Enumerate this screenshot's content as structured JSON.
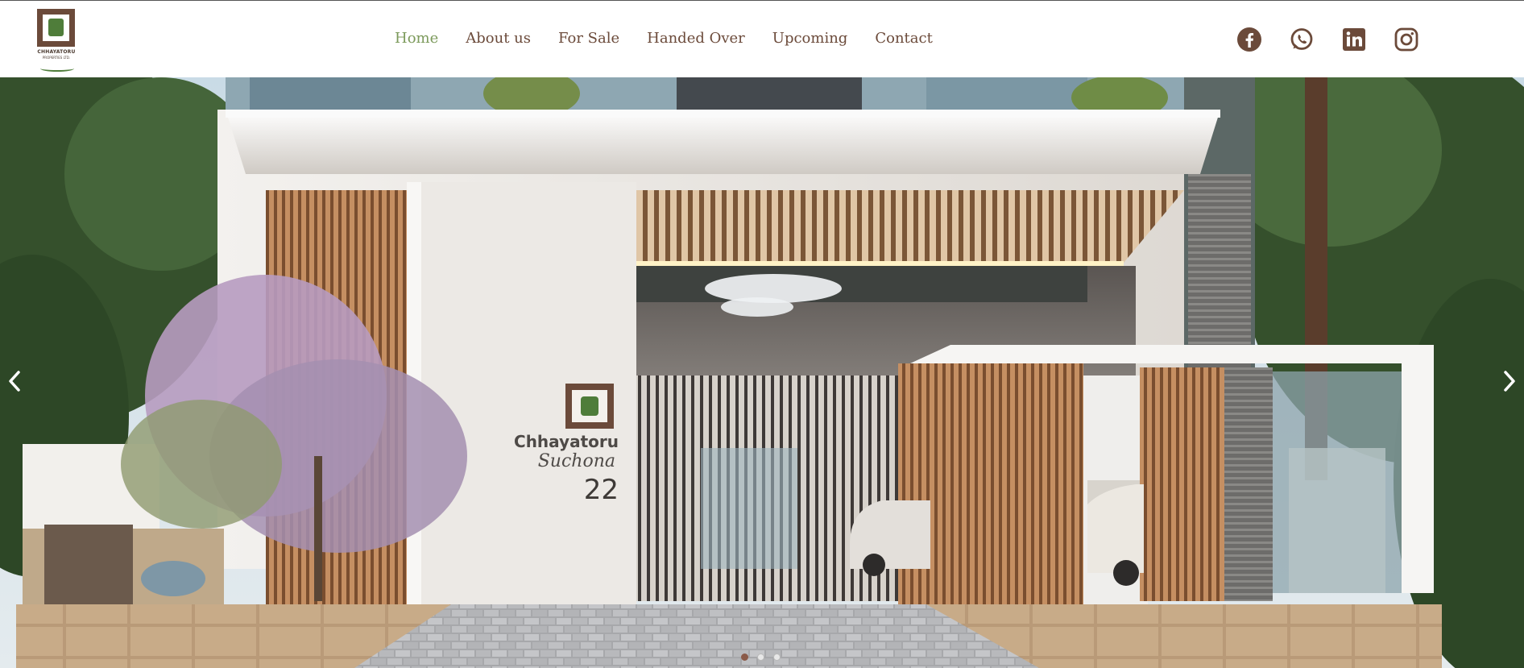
{
  "brand": {
    "logo_name": "CHHAYATORU",
    "logo_sub": "PROPERTIES LTD."
  },
  "nav": {
    "items": [
      {
        "label": "Home",
        "active": true
      },
      {
        "label": "About us"
      },
      {
        "label": "For Sale"
      },
      {
        "label": "Handed Over"
      },
      {
        "label": "Upcoming"
      },
      {
        "label": "Contact"
      }
    ]
  },
  "social": [
    "facebook-icon",
    "whatsapp-icon",
    "linkedin-icon",
    "instagram-icon"
  ],
  "hero": {
    "signage": {
      "line1": "Chhayatoru",
      "line2": "Suchona",
      "line3": "22"
    },
    "slides_total": 3,
    "active_slide": 1
  },
  "colors": {
    "brand_brown": "#6b4a3a",
    "nav_active": "#7c9a5b",
    "leaf_green": "#4f7d3a"
  }
}
